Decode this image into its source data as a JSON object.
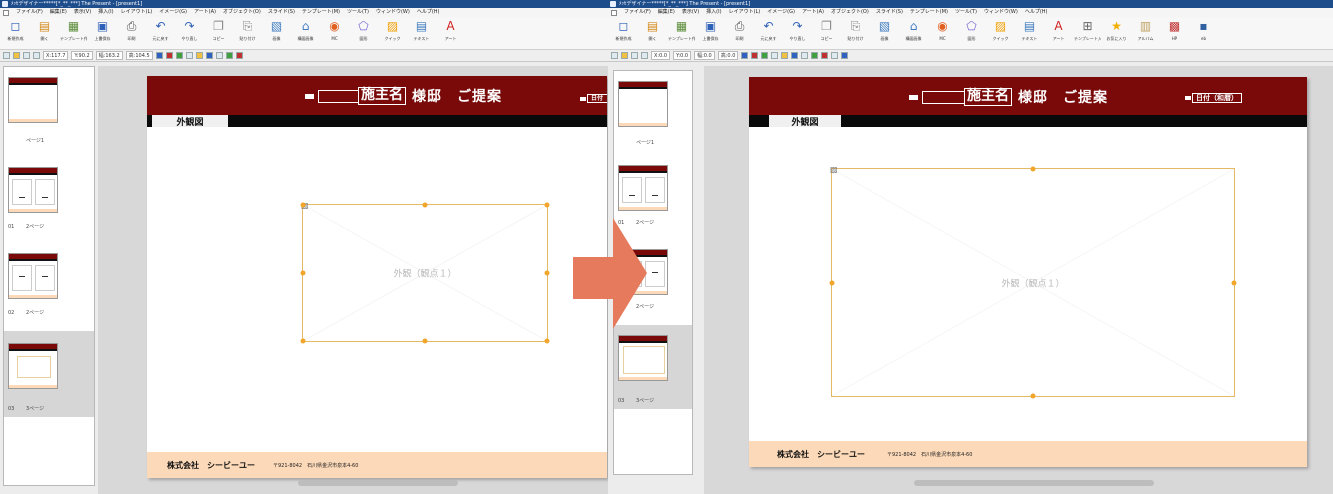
{
  "window": {
    "title": "ﾒｯｾデザイナー*****[*_**_***] The Present - [present1]"
  },
  "menu": [
    "ファイル(F)",
    "編集(E)",
    "表示(V)",
    "挿入(I)",
    "レイアウト(L)",
    "イメージ(G)",
    "アート(A)",
    "オブジェクト(O)",
    "スライド(S)",
    "テンプレート(M)",
    "ツール(T)",
    "ウィンドウ(W)",
    "ヘルプ(H)"
  ],
  "toolbar": [
    {
      "label": "新規作成",
      "icon": "new-document-icon",
      "glyph": "◻"
    },
    {
      "label": "開く",
      "icon": "open-folder-icon",
      "glyph": "▤"
    },
    {
      "label": "テンプレート作成",
      "icon": "template-icon",
      "glyph": "▦"
    },
    {
      "label": "上書保存",
      "icon": "save-icon",
      "glyph": "▣"
    },
    {
      "label": "印刷",
      "icon": "print-icon",
      "glyph": "⎙"
    },
    {
      "label": "元に戻す",
      "icon": "undo-icon",
      "glyph": "↶"
    },
    {
      "label": "やり直し",
      "icon": "redo-icon",
      "glyph": "↷"
    },
    {
      "label": "コピー",
      "icon": "copy-icon",
      "glyph": "❐"
    },
    {
      "label": "貼り付け",
      "icon": "paste-icon",
      "glyph": "⎘"
    },
    {
      "label": "画像",
      "icon": "image-icon",
      "glyph": "▧"
    },
    {
      "label": "構図画像",
      "icon": "house-image-icon",
      "glyph": "⌂"
    },
    {
      "label": "MC",
      "icon": "mc-icon",
      "glyph": "◉"
    },
    {
      "label": "図形",
      "icon": "shape-icon",
      "glyph": "⬠"
    },
    {
      "label": "クイック",
      "icon": "quick-icon",
      "glyph": "▨"
    },
    {
      "label": "テキスト",
      "icon": "text-icon",
      "glyph": "▤"
    },
    {
      "label": "アート",
      "icon": "art-text-icon",
      "glyph": "A"
    },
    {
      "label": "テンプレート入替",
      "icon": "template-swap-icon",
      "glyph": "⊞"
    },
    {
      "label": "お気に入り",
      "icon": "favorite-star-icon",
      "glyph": "★"
    },
    {
      "label": "アルバム",
      "icon": "album-icon",
      "glyph": "▥"
    },
    {
      "label": "HP",
      "icon": "hp-icon",
      "glyph": "▩"
    },
    {
      "label": "eb",
      "icon": "eb-icon",
      "glyph": "▪"
    }
  ],
  "coords": {
    "x": "X:117.7",
    "y": "Y:90.2",
    "w": "幅:163.2",
    "h": "高:104.5"
  },
  "coords_after": {
    "x": "X:0.0",
    "y": "Y:0.0",
    "w": "幅:0.0",
    "h": "高:0.0"
  },
  "pages": [
    {
      "label": "ページ1",
      "number": ""
    },
    {
      "label": "2ページ",
      "number": "01"
    },
    {
      "label": "2ページ",
      "number": "02"
    },
    {
      "label": "3ページ",
      "number": "03"
    }
  ],
  "doc": {
    "owner_box": "施主名",
    "title_suffix": "様邸　ご提案",
    "date_box": "日付（和暦）",
    "section": "外観図",
    "frame_caption": "外観（観点１）",
    "company": "株式会社　シービーユー",
    "address": "〒921-8042　石川県金沢市泉本4-60"
  },
  "colors": {
    "header": "#7a0a0a",
    "footer": "#fcd9b8",
    "frame": "#e3b968",
    "handle": "#f1a52a",
    "arrow": "#e57a5c"
  }
}
